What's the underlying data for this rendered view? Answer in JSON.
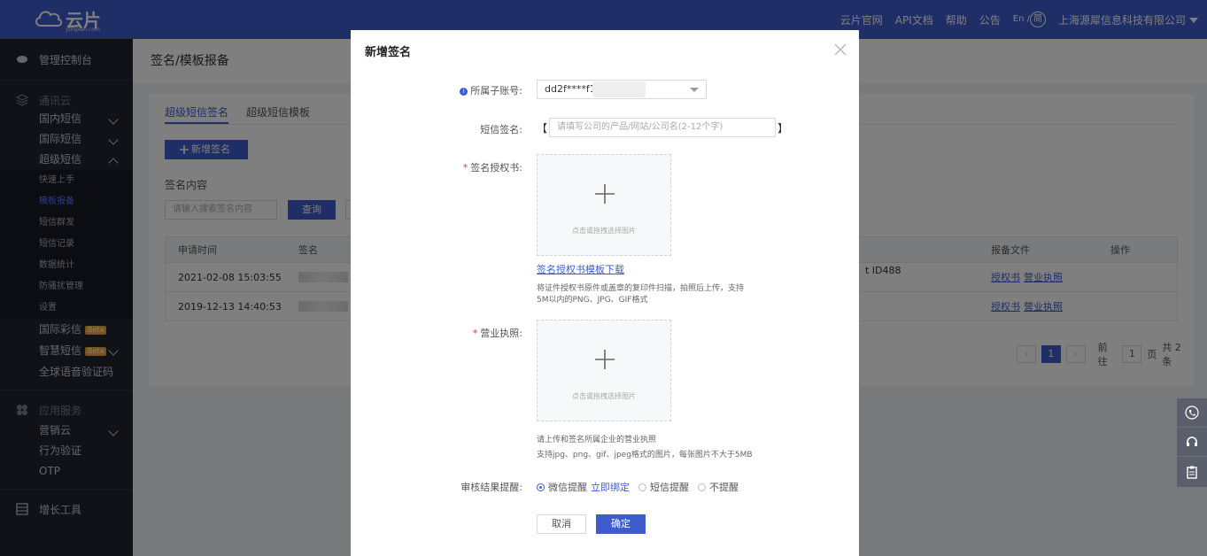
{
  "brand": {
    "name": "云片",
    "sub": "yunpian.com"
  },
  "topnav": {
    "links": [
      "云片官网",
      "API文档",
      "帮助",
      "公告"
    ],
    "lang": "En /",
    "lang_alt": "简",
    "company": "上海源犀信息科技有限公司"
  },
  "sidebar": {
    "console": "管理控制台",
    "comm_cloud": "通讯云",
    "domestic_sms": "国内短信",
    "intl_sms": "国际短信",
    "super_sms": "超级短信",
    "sub_items": [
      "快速上手",
      "模板报备",
      "短信群发",
      "短信记录",
      "数据统计",
      "防骚扰管理",
      "设置"
    ],
    "intl_mms": "国际彩信",
    "smart_sms": "智慧短信",
    "beta": "Beta",
    "global_voice": "全球语音验证码",
    "app_service": "应用服务",
    "marketing_cloud": "营销云",
    "behavior_verify": "行为验证",
    "otp": "OTP",
    "growth_tools": "增长工具"
  },
  "page": {
    "title": "签名/模板报备",
    "tabs": [
      "超级短信签名",
      "超级短信模板"
    ],
    "add_button": "新增签名",
    "content_label": "签名内容",
    "search_placeholder": "请输入搜索签名内容",
    "query_button": "查询",
    "table": {
      "headers": [
        "申请时间",
        "签名",
        "报备文件",
        "操作"
      ],
      "rows": [
        {
          "time": "2021-02-08 15:03:55",
          "extra": "t ID488",
          "files": [
            "授权书",
            "营业执照"
          ]
        },
        {
          "time": "2019-12-13 14:40:53",
          "files": [
            "授权书",
            "营业执照"
          ]
        }
      ]
    },
    "pager": {
      "current": "1",
      "goto": "前往",
      "page_input": "1",
      "page_unit": "页",
      "total": "共 2 条"
    }
  },
  "modal": {
    "title": "新增签名",
    "subaccount_label": "所属子账号:",
    "subaccount_value": "dd2f****f1e6",
    "signature_label": "短信签名:",
    "signature_open": "【",
    "signature_close": "】",
    "signature_placeholder": "请填写公司的产品/网站/公司名(2-12个字)",
    "auth_label": "签名授权书:",
    "upload_text": "点击或拖拽选择图片",
    "auth_template_link": "签名授权书模板下载",
    "auth_hint_1": "将证件授权书原件或盖章的复印件扫描，拍照后上传，支持",
    "auth_hint_2": "5M以内的PNG、JPG、GIF格式",
    "license_label": "营业执照:",
    "license_hint_1": "请上传和签名所属企业的营业执照",
    "license_hint_2": "支持jpg、png、gif、jpeg格式的图片，每张图片不大于5MB",
    "review_label": "审核结果提醒:",
    "opt_wechat": "微信提醒",
    "bind_now": "立即绑定",
    "opt_sms": "短信提醒",
    "opt_none": "不提醒",
    "cancel": "取消",
    "confirm": "确定"
  },
  "colors": {
    "primary": "#3f5ccc",
    "sidebar": "#202431"
  }
}
